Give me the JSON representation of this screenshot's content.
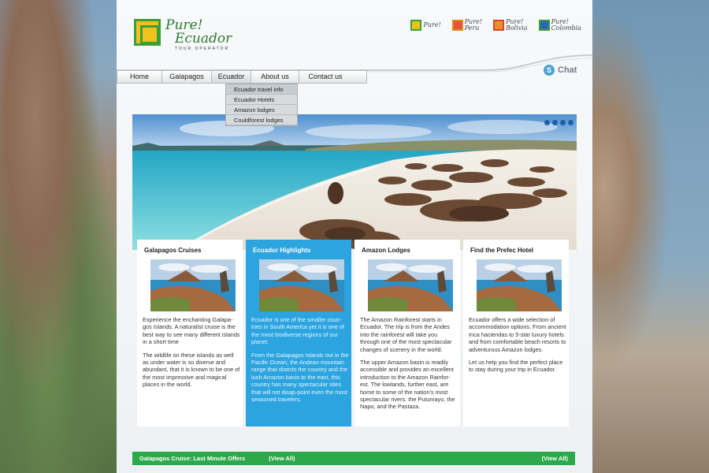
{
  "logo": {
    "line1": "Pure!",
    "line2": "Ecuador",
    "tagline": "TOUR OPERATOR"
  },
  "country_sites": [
    {
      "label1": "Pure!",
      "label2": "",
      "icon": "brand-logo-icon"
    },
    {
      "label1": "Pure!",
      "label2": "Peru",
      "icon": "brand-logo-icon"
    },
    {
      "label1": "Pure!",
      "label2": "Bolivia",
      "icon": "brand-logo-icon"
    },
    {
      "label1": "Pure!",
      "label2": "Colombia",
      "icon": "brand-logo-icon"
    }
  ],
  "chat": {
    "label": "Chat",
    "icon": "skype-icon"
  },
  "nav": {
    "items": [
      "Home",
      "Galapagos",
      "Ecuador",
      "About us",
      "Contact us"
    ],
    "active": "Ecuador"
  },
  "dropdown": {
    "items": [
      "Ecuador travel info",
      "Ecuador Hotels",
      "Amazon lodges",
      "Couldforest lodges"
    ]
  },
  "hero": {
    "dot_count": 4
  },
  "cards": [
    {
      "title": "Galapagos Cruises",
      "p1": "Experience the enchanting Galapa-gos Islands. A naturalist cruise is the best way to see many different islands in a short time",
      "p2": "The wildlife on these islands as well as under water is so diverse and abundant, that it is known to be one of the most impressive and magical places in the world."
    },
    {
      "title": "Ecuador Highlights",
      "p1": "Ecuador is one of the smaller coun-tries in South America yet it is one of the most biodiverse regions of our planet.",
      "p2": "From the Galapagos Islands out in the Pacific Ocean, the Andean mountain range that disects the country and the lush Amazon basin to the east, this country has many spectacular sites that will not disap-point even the most seasoned travelers."
    },
    {
      "title": "Amazon Lodges",
      "p1": "The Amazon Rainforest starts in Ecuador. The trip is from the Andes into the rainforest will take you through one of the most spectacular changes of scenery in the world.",
      "p2": "The upper Amazon basin is readily accessible and provides an excellent introduction to the Amazon Rainfor-est. The lowlands, further east, are home to some of the nation's most spectacular rivers: the Putumayo, the Napo, and the Pastaza."
    },
    {
      "title": "Find the Prefec Hotel",
      "p1": "Ecuador offers a wide selection of accommodation options. From ancient Inca haciendas to 5-star luxury hotels and from comfortable beach resorts to adventurous Amazon lodges.",
      "p2": "Let us help you find the perfect place to stay during your trip in Ecuador."
    }
  ],
  "bottom_bar": {
    "title": "Galapagos Cruise: Last Minute Offers",
    "view_all_1": "(View All)",
    "view_all_2": "(View All)"
  },
  "colors": {
    "accent_green": "#2da84b",
    "highlight_blue": "#2ba4df",
    "slider_dot": "#1c5ea8"
  }
}
